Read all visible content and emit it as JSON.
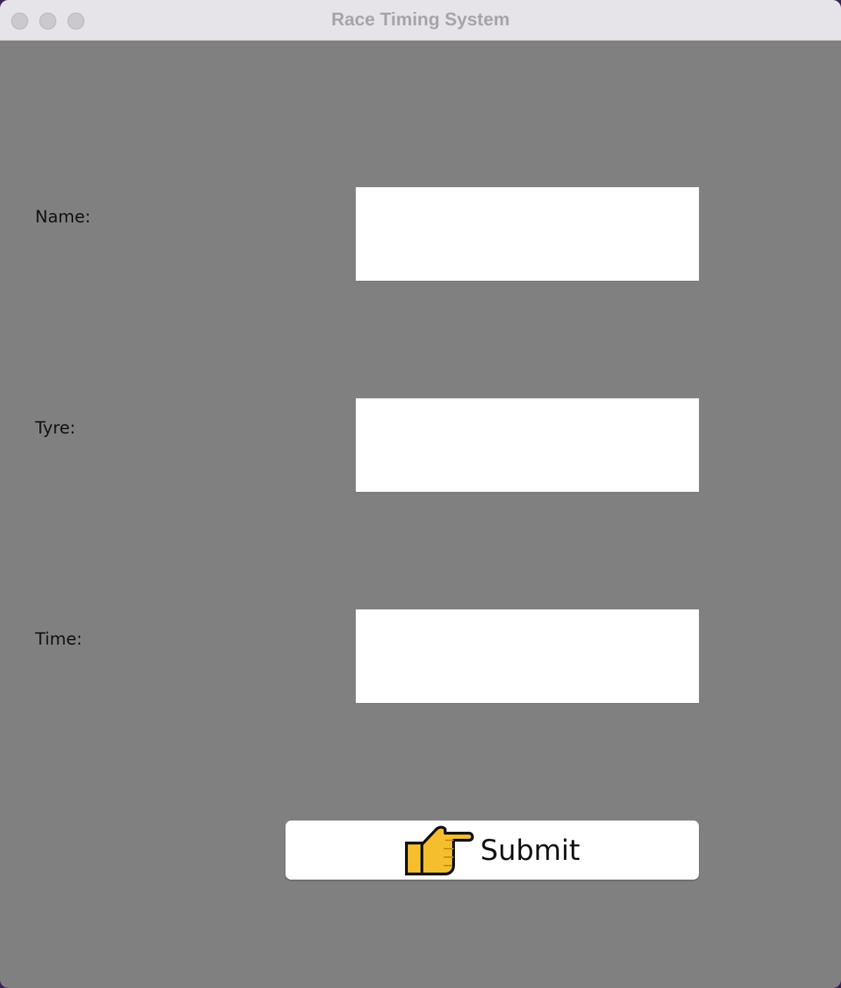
{
  "window": {
    "title": "Race Timing System"
  },
  "form": {
    "name_label": "Name:",
    "name_value": "",
    "tyre_label": "Tyre:",
    "tyre_value": "",
    "time_label": "Time:",
    "time_value": ""
  },
  "submit": {
    "icon": "pointing-hand-icon",
    "label": "Submit"
  },
  "colors": {
    "window_background": "#808080",
    "titlebar": "#e6e4e9",
    "field_background": "#ffffff",
    "icon_yellow": "#f5be2e"
  }
}
